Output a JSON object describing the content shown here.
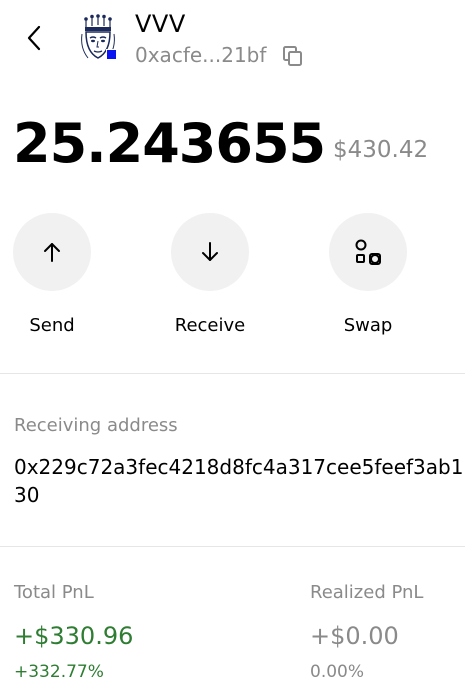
{
  "header": {
    "token_name": "VVV",
    "token_address": "0xacfe...21bf",
    "chain_badge_color": "#0a14f0",
    "icons": [
      "chevron-left-icon",
      "token-logo-icon",
      "copy-icon"
    ]
  },
  "balance": {
    "amount": "25.243655",
    "usd_value": "$430.42"
  },
  "actions": [
    {
      "label": "Send",
      "icon": "arrow-up-icon"
    },
    {
      "label": "Receive",
      "icon": "arrow-down-icon"
    },
    {
      "label": "Swap",
      "icon": "swap-icon"
    }
  ],
  "receiving": {
    "label": "Receiving address",
    "address": "0x229c72a3fec4218d8fc4a317cee5feef3ab130"
  },
  "pnl": {
    "total_label": "Total PnL",
    "total_value": "+$330.96",
    "total_pct": "+332.77%",
    "total_color": "#2e7d32",
    "realized_label": "Realized PnL",
    "realized_value": "+$0.00",
    "realized_pct": "0.00%"
  }
}
